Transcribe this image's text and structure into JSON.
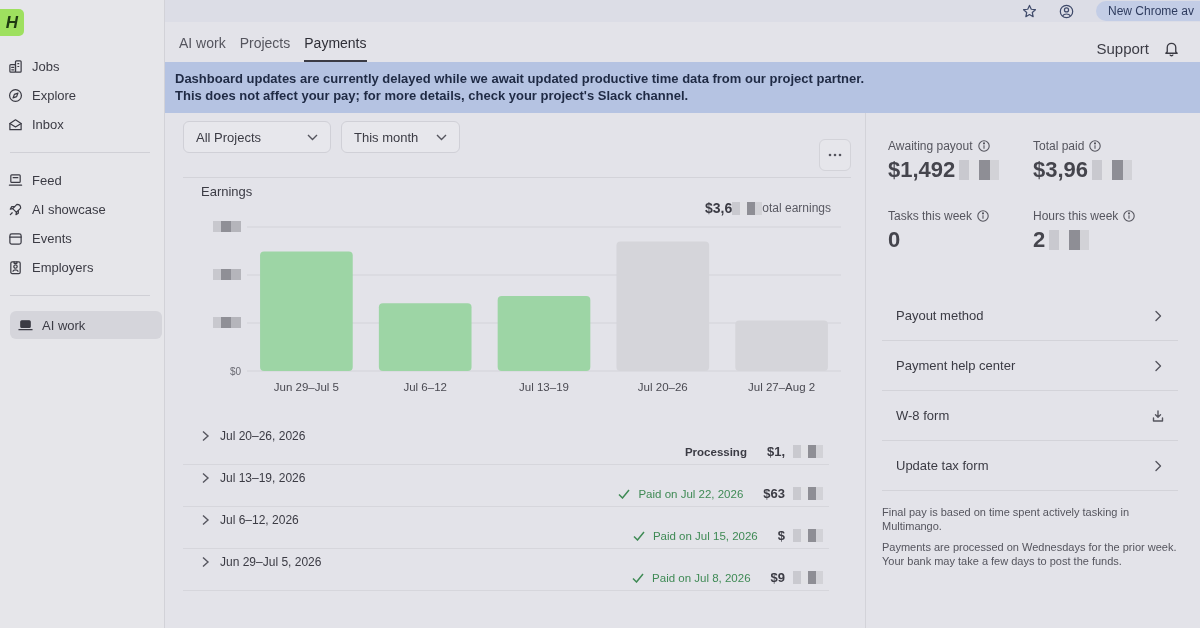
{
  "browser": {
    "update_chip": "New Chrome av"
  },
  "sidebar": {
    "logo": "H",
    "sections": [
      {
        "items": [
          {
            "label": "Jobs",
            "selected": false
          },
          {
            "label": "Explore",
            "selected": false
          },
          {
            "label": "Inbox",
            "selected": false
          }
        ]
      },
      {
        "items": [
          {
            "label": "Feed",
            "selected": false
          },
          {
            "label": "AI showcase",
            "selected": false
          },
          {
            "label": "Events",
            "selected": false
          },
          {
            "label": "Employers",
            "selected": false
          }
        ]
      },
      {
        "items": [
          {
            "label": "AI work",
            "selected": true
          }
        ]
      }
    ]
  },
  "tabs": [
    {
      "label": "AI work",
      "selected": false
    },
    {
      "label": "Projects",
      "selected": false
    },
    {
      "label": "Payments",
      "selected": true
    }
  ],
  "header": {
    "support": "Support"
  },
  "banner": {
    "lines": [
      "Dashboard updates are currently delayed while we await updated productive time data from our project partner.",
      "This does not affect your pay; for more details, check your project's Slack channel."
    ]
  },
  "filters": [
    {
      "value": "All Projects"
    },
    {
      "value": "This month"
    }
  ],
  "earnings": {
    "title": "Earnings",
    "total": "$3,6",
    "total_redacted": true,
    "total_label": "otal earnings",
    "y_ticks": [
      {
        "label": "$0",
        "redacted": false
      },
      {
        "redacted": true
      },
      {
        "redacted": true
      },
      {
        "redacted": true
      }
    ],
    "bars": [
      {
        "label": "Jun 29–Jul 5",
        "color": "#9dd5a5"
      },
      {
        "label": "Jul 6–12",
        "color": "#9dd5a5"
      },
      {
        "label": "Jul 13–19",
        "color": "#9dd5a5"
      },
      {
        "label": "Jul 20–26",
        "color": "#d5d5da"
      },
      {
        "label": "Jul 27–Aug 2",
        "color": "#d5d5da"
      }
    ]
  },
  "rows": [
    {
      "period": "Jul 20–26, 2026",
      "expanded": false,
      "kind": "processing",
      "status": "Processing",
      "amount": "$1,",
      "redacted": true
    },
    {
      "period": "Jul 13–19, 2026",
      "expanded": false,
      "kind": "paid",
      "status": "Paid on Jul 22, 2026",
      "amount": "$63",
      "redacted": true
    },
    {
      "period": "Jul 6–12, 2026",
      "expanded": false,
      "kind": "paid",
      "status": "Paid on Jul 15, 2026",
      "amount": "$",
      "redacted": true
    },
    {
      "period": "Jun 29–Jul 5, 2026",
      "expanded": false,
      "kind": "paid",
      "status": "Paid on Jul 8, 2026",
      "amount": "$9",
      "redacted": true
    }
  ],
  "stats": [
    {
      "label": "Awaiting payout",
      "value": "$1,492",
      "redacted": true
    },
    {
      "label": "Total paid",
      "value": "$3,96",
      "redacted": true
    },
    {
      "label": "Tasks this week",
      "value": "0",
      "redacted": false
    },
    {
      "label": "Hours this week",
      "value": "2",
      "redacted": true
    }
  ],
  "links": [
    {
      "label": "Payout method",
      "kind": "link"
    },
    {
      "label": "Payment help center",
      "kind": "link"
    },
    {
      "label": "W-8 form",
      "kind": "download"
    },
    {
      "label": "Update tax form",
      "kind": "link"
    }
  ],
  "notes": [
    "Final pay is based on time spent actively tasking in Multimango.",
    "Payments are processed on Wednesdays for the prior week. Your bank may take a few days to post the funds."
  ]
}
